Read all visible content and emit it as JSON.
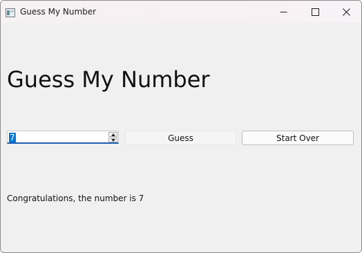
{
  "window": {
    "title": "Guess My Number",
    "controls": {
      "minimize_icon": "minimize-icon",
      "maximize_icon": "maximize-icon",
      "close_icon": "close-icon"
    }
  },
  "main": {
    "heading": "Guess My Number",
    "guess_input": {
      "value": "7"
    },
    "guess_button_label": "Guess",
    "start_over_button_label": "Start Over",
    "result_message": "Congratulations, the number is 7"
  },
  "colors": {
    "selection": "#0078d7",
    "focus_underline": "#1f5fb4",
    "background": "#f0f0f0"
  }
}
